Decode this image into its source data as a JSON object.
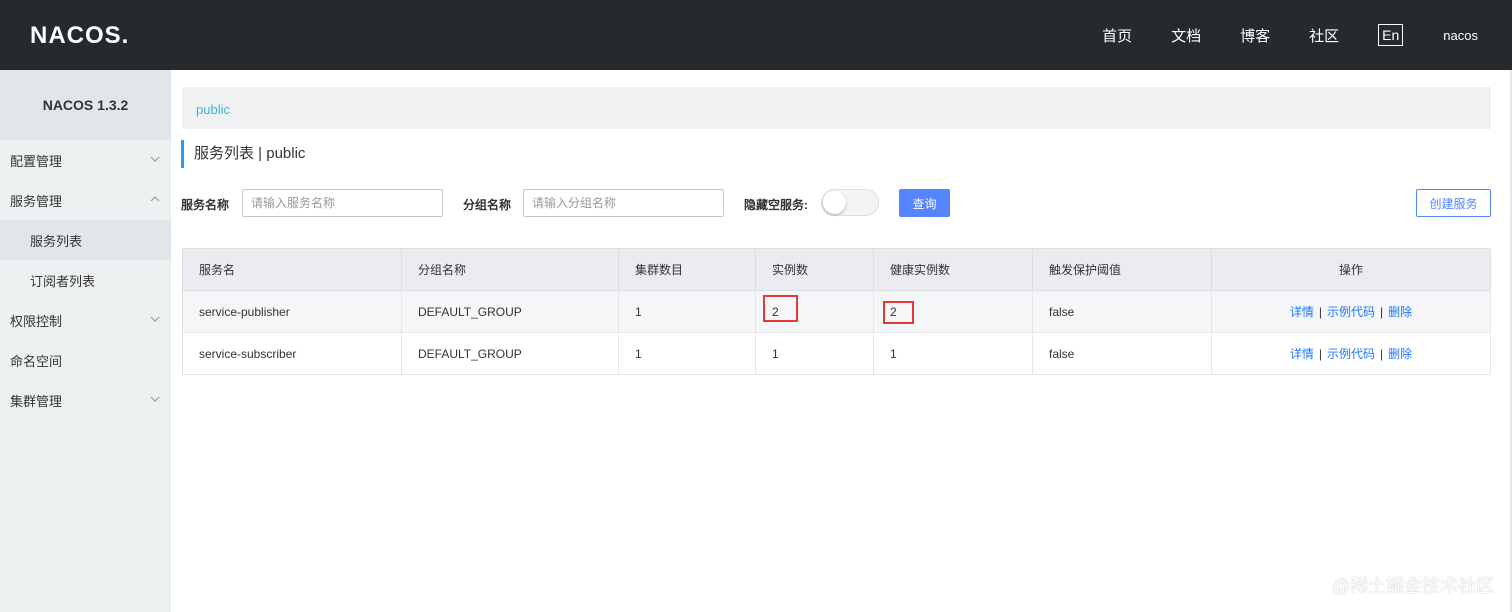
{
  "header": {
    "logo": "NACOS.",
    "nav": [
      "首页",
      "文档",
      "博客",
      "社区"
    ],
    "lang": "En",
    "user": "nacos"
  },
  "sidebar": {
    "version": "NACOS 1.3.2",
    "items": [
      {
        "label": "配置管理",
        "chevron": "down"
      },
      {
        "label": "服务管理",
        "chevron": "up"
      },
      {
        "label": "服务列表",
        "sub": true,
        "active": true
      },
      {
        "label": "订阅者列表",
        "sub": true
      },
      {
        "label": "权限控制",
        "chevron": "down"
      },
      {
        "label": "命名空间"
      },
      {
        "label": "集群管理",
        "chevron": "down"
      }
    ]
  },
  "breadcrumb": "public",
  "page_title": "服务列表 | public",
  "filters": {
    "service_label": "服务名称",
    "service_placeholder": "请输入服务名称",
    "group_label": "分组名称",
    "group_placeholder": "请输入分组名称",
    "hide_empty_label": "隐藏空服务:",
    "query_button": "查询",
    "create_button": "创建服务"
  },
  "table": {
    "columns": [
      "服务名",
      "分组名称",
      "集群数目",
      "实例数",
      "健康实例数",
      "触发保护阈值",
      "操作"
    ],
    "rows": [
      [
        "service-publisher",
        "DEFAULT_GROUP",
        "1",
        "2",
        "2",
        "false"
      ],
      [
        "service-subscriber",
        "DEFAULT_GROUP",
        "1",
        "1",
        "1",
        "false"
      ]
    ],
    "actions": [
      "详情",
      "示例代码",
      "删除"
    ],
    "action_sep": "|"
  },
  "watermark": "@稀土掘金技术社区",
  "colors": {
    "topbar": "#252a2f",
    "primary": "#5584ff",
    "link": "#2077ff",
    "highlight": "#e53935"
  }
}
